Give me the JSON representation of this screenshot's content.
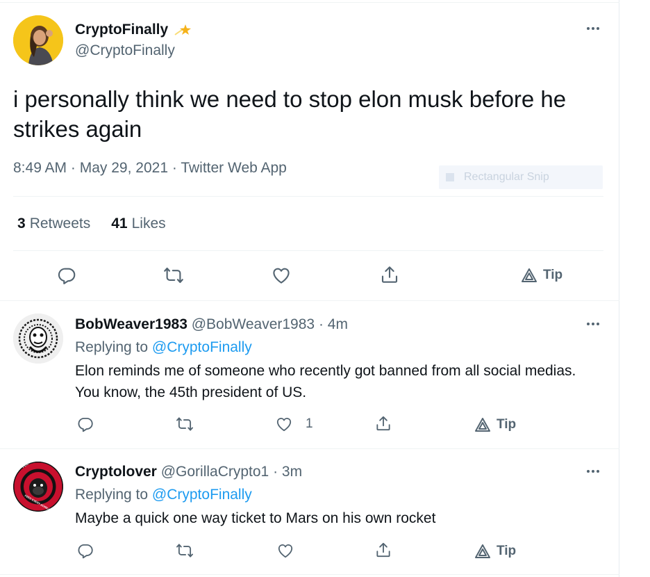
{
  "main_tweet": {
    "display_name": "CryptoFinally",
    "name_emoji": "💫",
    "handle": "@CryptoFinally",
    "text": "i personally think we need to stop elon musk before he strikes again",
    "time": "8:49 AM",
    "sep1": "·",
    "date": "May 29, 2021",
    "sep2": "·",
    "source": "Twitter Web App",
    "snip_overlay": "Rectangular Snip",
    "retweets_count": "3",
    "retweets_label": "Retweets",
    "likes_count": "41",
    "likes_label": "Likes",
    "tip_label": "Tip",
    "icons": {
      "reply": "reply-icon",
      "retweet": "retweet-icon",
      "like": "heart-icon",
      "share": "share-icon",
      "tip": "tip-icon",
      "more": "more-icon"
    }
  },
  "replies": [
    {
      "display_name": "BobWeaver1983",
      "handle": "@BobWeaver1983",
      "time": "· 4m",
      "replying_prefix": "Replying to",
      "replying_to": "@CryptoFinally",
      "text": "Elon reminds me of someone who recently got banned from all social medias. You know, the 45th president of US.",
      "like_count": "1",
      "tip_label": "Tip"
    },
    {
      "display_name": "Cryptolover",
      "handle": "@GorillaCrypto1",
      "time": "· 3m",
      "replying_prefix": "Replying to",
      "replying_to": "@CryptoFinally",
      "text": "Maybe a quick one way ticket to Mars on his own rocket",
      "like_count": "",
      "tip_label": "Tip",
      "avatar_ring_top": "FEGTOKEN.COM",
      "avatar_ring_bottom": "FEED EVERY GORILLA"
    }
  ],
  "colors": {
    "text": "#0f1419",
    "muted": "#536471",
    "link": "#1d9bf0",
    "border": "#eff3f4",
    "avatar_main_bg": "#f5c51a",
    "avatar_fegtoken_red": "#c8102e"
  }
}
